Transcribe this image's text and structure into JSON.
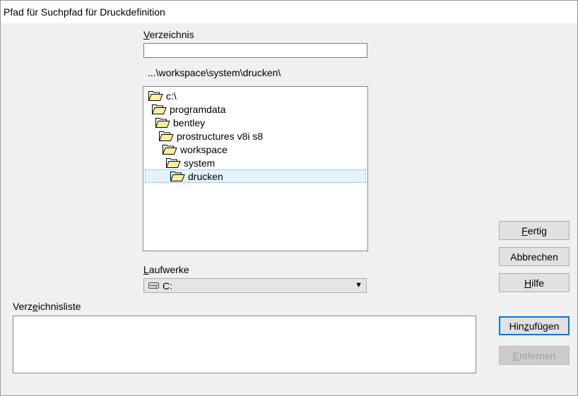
{
  "window": {
    "title": "Pfad für Suchpfad für Druckdefinition"
  },
  "directory": {
    "label_pre": "",
    "label_key": "V",
    "label_post": "erzeichnis",
    "value": "",
    "current_path": "...\\workspace\\system\\drucken\\"
  },
  "tree": {
    "items": [
      {
        "label": "c:\\",
        "level": 0,
        "open": true,
        "selected": false
      },
      {
        "label": "programdata",
        "level": 1,
        "open": true,
        "selected": false
      },
      {
        "label": "bentley",
        "level": 2,
        "open": true,
        "selected": false
      },
      {
        "label": "prostructures v8i s8",
        "level": 3,
        "open": true,
        "selected": false
      },
      {
        "label": "workspace",
        "level": 4,
        "open": true,
        "selected": false
      },
      {
        "label": "system",
        "level": 5,
        "open": true,
        "selected": false
      },
      {
        "label": "drucken",
        "level": 6,
        "open": true,
        "selected": true
      }
    ]
  },
  "drives": {
    "label_pre": "",
    "label_key": "L",
    "label_post": "aufwerke",
    "selected": "C:",
    "icon": "drive-icon"
  },
  "dirlist": {
    "label_pre": "Verz",
    "label_key": "e",
    "label_post": "ichnisliste",
    "items": []
  },
  "buttons": {
    "done": {
      "pre": "",
      "key": "F",
      "post": "ertig"
    },
    "cancel": {
      "pre": "Abbrechen",
      "key": "",
      "post": ""
    },
    "help": {
      "pre": "",
      "key": "H",
      "post": "ilfe"
    },
    "add": {
      "pre": "Hin",
      "key": "z",
      "post": "ufügen"
    },
    "remove": {
      "pre": "",
      "key": "E",
      "post": "ntfernen"
    }
  },
  "colors": {
    "selection_bg": "#e5f3ff",
    "selection_border": "#99d1ff",
    "default_button_border": "#0078d7",
    "folder_fill": "#ffef9f"
  }
}
